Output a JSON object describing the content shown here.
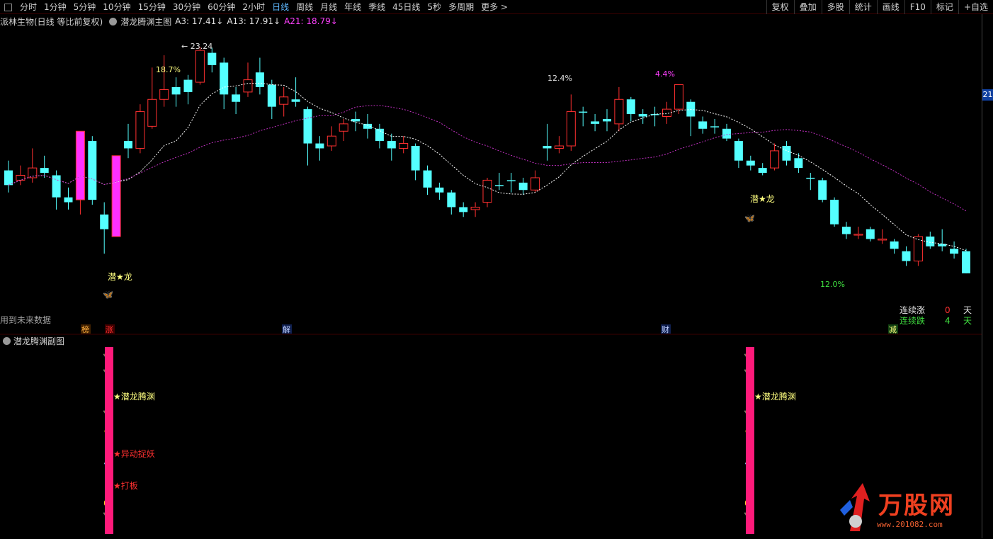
{
  "toolbar": {
    "periods": [
      "分时",
      "1分钟",
      "5分钟",
      "10分钟",
      "15分钟",
      "30分钟",
      "60分钟",
      "2小时",
      "日线",
      "周线",
      "月线",
      "年线",
      "季线",
      "45日线",
      "5秒",
      "多周期",
      "更多 >"
    ],
    "active_period": "日线",
    "right_items": [
      "复权",
      "叠加",
      "多股",
      "统计",
      "画线",
      "F10",
      "标记",
      "+自选"
    ]
  },
  "main_panel": {
    "stock_label": "派林生物(日线 等比前复权)",
    "indicator_name": "潜龙腾渊主图",
    "a3": "A3: 17.41↓",
    "a13": "A13: 17.91↓",
    "a21": "A21: 18.79↓",
    "colors": {
      "a3": "#e0e0e0",
      "a13": "#e0e0e0",
      "a21": "#ff40ff"
    },
    "note_left": "用到未来数据",
    "right_badge": "21"
  },
  "annotations": {
    "high_price": "23.24",
    "pct_1": "18.7%",
    "pct_2": "12.4%",
    "pct_3": "4.4%",
    "pct_4": "12.0%",
    "qianlong_1": "潜★龙",
    "qianlong_2": "潜★龙",
    "streak_label": "连续涨",
    "streak_label2": "连续跌",
    "streak_up_value": "0",
    "streak_down_value": "4",
    "day_1": "天",
    "day_2": "天",
    "markers": [
      "榜",
      "涨",
      "解",
      "财",
      "减"
    ]
  },
  "sub_panel": {
    "title": "潜龙腾渊副图",
    "label_1": "★潜龙腾渊",
    "label_2": "★异动捉妖",
    "label_3": "★打板",
    "label_4": "★潜龙腾渊"
  },
  "logo": {
    "text": "万股网",
    "url": "www.201082.com"
  },
  "chart_data": {
    "type": "candlestick",
    "price_range": [
      12.0,
      24.0
    ],
    "candles": [
      {
        "o": 18.2,
        "c": 17.6,
        "h": 18.6,
        "l": 17.3,
        "up": false
      },
      {
        "o": 17.8,
        "c": 18.0,
        "h": 18.4,
        "l": 17.6,
        "up": true
      },
      {
        "o": 17.9,
        "c": 18.3,
        "h": 19.1,
        "l": 17.7,
        "up": true
      },
      {
        "o": 18.3,
        "c": 18.1,
        "h": 18.8,
        "l": 17.9,
        "up": false
      },
      {
        "o": 18.0,
        "c": 17.1,
        "h": 18.2,
        "l": 16.6,
        "up": false
      },
      {
        "o": 17.1,
        "c": 16.9,
        "h": 17.5,
        "l": 16.6,
        "up": false
      },
      {
        "o": 17.0,
        "c": 19.8,
        "h": 19.8,
        "l": 16.4,
        "up": true,
        "magenta": true
      },
      {
        "o": 19.4,
        "c": 17.0,
        "h": 19.6,
        "l": 16.8,
        "up": false
      },
      {
        "o": 16.4,
        "c": 15.8,
        "h": 16.9,
        "l": 14.8,
        "up": false
      },
      {
        "o": 15.5,
        "c": 18.8,
        "h": 18.8,
        "l": 15.5,
        "up": true,
        "magenta": true
      },
      {
        "o": 19.4,
        "c": 19.1,
        "h": 20.1,
        "l": 18.7,
        "up": false
      },
      {
        "o": 19.1,
        "c": 20.6,
        "h": 20.9,
        "l": 18.9,
        "up": true
      },
      {
        "o": 20.0,
        "c": 21.1,
        "h": 22.4,
        "l": 19.9,
        "up": true
      },
      {
        "o": 21.1,
        "c": 21.5,
        "h": 22.9,
        "l": 20.8,
        "up": true
      },
      {
        "o": 21.6,
        "c": 21.3,
        "h": 22.0,
        "l": 20.8,
        "up": false
      },
      {
        "o": 21.9,
        "c": 21.4,
        "h": 22.1,
        "l": 20.9,
        "up": false
      },
      {
        "o": 21.8,
        "c": 23.1,
        "h": 23.24,
        "l": 21.7,
        "up": true
      },
      {
        "o": 23.0,
        "c": 22.5,
        "h": 23.2,
        "l": 22.2,
        "up": false
      },
      {
        "o": 22.6,
        "c": 21.3,
        "h": 22.8,
        "l": 20.7,
        "up": false
      },
      {
        "o": 21.3,
        "c": 21.0,
        "h": 21.6,
        "l": 20.5,
        "up": false
      },
      {
        "o": 21.4,
        "c": 21.9,
        "h": 22.6,
        "l": 21.2,
        "up": true
      },
      {
        "o": 22.2,
        "c": 21.6,
        "h": 22.8,
        "l": 21.3,
        "up": false
      },
      {
        "o": 21.7,
        "c": 20.8,
        "h": 21.9,
        "l": 20.3,
        "up": false
      },
      {
        "o": 20.9,
        "c": 21.2,
        "h": 21.6,
        "l": 20.4,
        "up": true
      },
      {
        "o": 21.1,
        "c": 21.0,
        "h": 22.0,
        "l": 20.8,
        "up": false
      },
      {
        "o": 20.7,
        "c": 19.3,
        "h": 20.8,
        "l": 18.4,
        "up": false
      },
      {
        "o": 19.3,
        "c": 19.1,
        "h": 19.6,
        "l": 18.6,
        "up": false
      },
      {
        "o": 19.2,
        "c": 19.6,
        "h": 20.0,
        "l": 19.0,
        "up": true
      },
      {
        "o": 19.8,
        "c": 20.1,
        "h": 20.3,
        "l": 19.4,
        "up": true
      },
      {
        "o": 20.3,
        "c": 20.2,
        "h": 20.6,
        "l": 19.8,
        "up": false
      },
      {
        "o": 20.1,
        "c": 19.9,
        "h": 20.5,
        "l": 19.5,
        "up": false
      },
      {
        "o": 19.9,
        "c": 19.4,
        "h": 20.1,
        "l": 19.1,
        "up": false
      },
      {
        "o": 19.4,
        "c": 19.1,
        "h": 19.7,
        "l": 18.6,
        "up": false
      },
      {
        "o": 19.1,
        "c": 19.3,
        "h": 19.6,
        "l": 18.9,
        "up": true
      },
      {
        "o": 19.2,
        "c": 18.2,
        "h": 19.3,
        "l": 17.8,
        "up": false
      },
      {
        "o": 18.2,
        "c": 17.5,
        "h": 18.4,
        "l": 17.2,
        "up": false
      },
      {
        "o": 17.5,
        "c": 17.3,
        "h": 17.7,
        "l": 17.0,
        "up": false
      },
      {
        "o": 17.3,
        "c": 16.7,
        "h": 17.4,
        "l": 16.4,
        "up": false
      },
      {
        "o": 16.7,
        "c": 16.5,
        "h": 16.9,
        "l": 16.3,
        "up": false
      },
      {
        "o": 16.6,
        "c": 16.7,
        "h": 16.9,
        "l": 16.3,
        "up": true
      },
      {
        "o": 16.9,
        "c": 17.8,
        "h": 17.9,
        "l": 16.7,
        "up": true
      },
      {
        "o": 17.6,
        "c": 17.6,
        "h": 18.1,
        "l": 17.4,
        "up": false
      },
      {
        "o": 17.8,
        "c": 17.8,
        "h": 18.1,
        "l": 17.3,
        "up": false
      },
      {
        "o": 17.7,
        "c": 17.4,
        "h": 17.9,
        "l": 17.2,
        "up": false
      },
      {
        "o": 17.4,
        "c": 17.9,
        "h": 18.2,
        "l": 17.3,
        "up": true
      },
      {
        "o": 19.2,
        "c": 19.1,
        "h": 20.1,
        "l": 18.6,
        "up": false
      },
      {
        "o": 19.1,
        "c": 19.2,
        "h": 19.6,
        "l": 18.9,
        "up": true
      },
      {
        "o": 19.2,
        "c": 20.6,
        "h": 21.3,
        "l": 19.0,
        "up": true
      },
      {
        "o": 20.6,
        "c": 20.6,
        "h": 20.8,
        "l": 20.0,
        "up": false
      },
      {
        "o": 20.2,
        "c": 20.1,
        "h": 20.5,
        "l": 19.8,
        "up": false
      },
      {
        "o": 20.3,
        "c": 20.2,
        "h": 20.7,
        "l": 19.8,
        "up": false
      },
      {
        "o": 20.1,
        "c": 21.1,
        "h": 21.6,
        "l": 19.8,
        "up": true
      },
      {
        "o": 21.1,
        "c": 20.5,
        "h": 21.2,
        "l": 20.2,
        "up": false
      },
      {
        "o": 20.5,
        "c": 20.4,
        "h": 20.7,
        "l": 20.1,
        "up": false
      },
      {
        "o": 20.5,
        "c": 20.5,
        "h": 20.8,
        "l": 20.0,
        "up": false
      },
      {
        "o": 20.4,
        "c": 20.7,
        "h": 21.0,
        "l": 20.1,
        "up": true
      },
      {
        "o": 20.7,
        "c": 21.7,
        "h": 21.7,
        "l": 20.5,
        "up": true
      },
      {
        "o": 21.0,
        "c": 20.4,
        "h": 21.1,
        "l": 19.6,
        "up": false
      },
      {
        "o": 20.2,
        "c": 19.9,
        "h": 20.4,
        "l": 19.7,
        "up": false
      },
      {
        "o": 20.0,
        "c": 20.0,
        "h": 20.3,
        "l": 19.7,
        "up": false
      },
      {
        "o": 19.9,
        "c": 19.5,
        "h": 20.1,
        "l": 19.4,
        "up": false
      },
      {
        "o": 19.4,
        "c": 18.6,
        "h": 19.5,
        "l": 18.3,
        "up": false
      },
      {
        "o": 18.6,
        "c": 18.4,
        "h": 18.8,
        "l": 18.2,
        "up": false
      },
      {
        "o": 18.3,
        "c": 18.1,
        "h": 18.5,
        "l": 18.0,
        "up": false
      },
      {
        "o": 18.3,
        "c": 19.0,
        "h": 19.3,
        "l": 18.2,
        "up": true
      },
      {
        "o": 19.2,
        "c": 18.6,
        "h": 19.4,
        "l": 18.4,
        "up": false
      },
      {
        "o": 18.7,
        "c": 18.3,
        "h": 18.9,
        "l": 18.1,
        "up": false
      },
      {
        "o": 17.9,
        "c": 17.9,
        "h": 18.1,
        "l": 17.4,
        "up": false
      },
      {
        "o": 17.8,
        "c": 17.0,
        "h": 17.9,
        "l": 16.9,
        "up": false
      },
      {
        "o": 17.0,
        "c": 16.0,
        "h": 17.1,
        "l": 15.9,
        "up": false
      },
      {
        "o": 15.9,
        "c": 15.6,
        "h": 16.1,
        "l": 15.4,
        "up": false
      },
      {
        "o": 15.6,
        "c": 15.6,
        "h": 15.9,
        "l": 15.4,
        "up": true
      },
      {
        "o": 15.8,
        "c": 15.4,
        "h": 15.9,
        "l": 15.3,
        "up": false
      },
      {
        "o": 15.4,
        "c": 15.4,
        "h": 15.8,
        "l": 15.2,
        "up": true
      },
      {
        "o": 15.3,
        "c": 15.0,
        "h": 15.4,
        "l": 14.8,
        "up": false
      },
      {
        "o": 14.9,
        "c": 14.5,
        "h": 15.1,
        "l": 14.3,
        "up": false
      },
      {
        "o": 14.5,
        "c": 15.5,
        "h": 15.6,
        "l": 14.3,
        "up": true
      },
      {
        "o": 15.5,
        "c": 15.1,
        "h": 15.7,
        "l": 15.0,
        "up": false
      },
      {
        "o": 15.2,
        "c": 15.1,
        "h": 15.8,
        "l": 14.9,
        "up": false
      },
      {
        "o": 15.0,
        "c": 14.8,
        "h": 15.3,
        "l": 14.6,
        "up": false
      },
      {
        "o": 14.9,
        "c": 14.0,
        "h": 15.0,
        "l": 14.0,
        "up": false
      }
    ],
    "ma_short_color": "#ffffff",
    "ma_long_color": "#c030c0"
  }
}
